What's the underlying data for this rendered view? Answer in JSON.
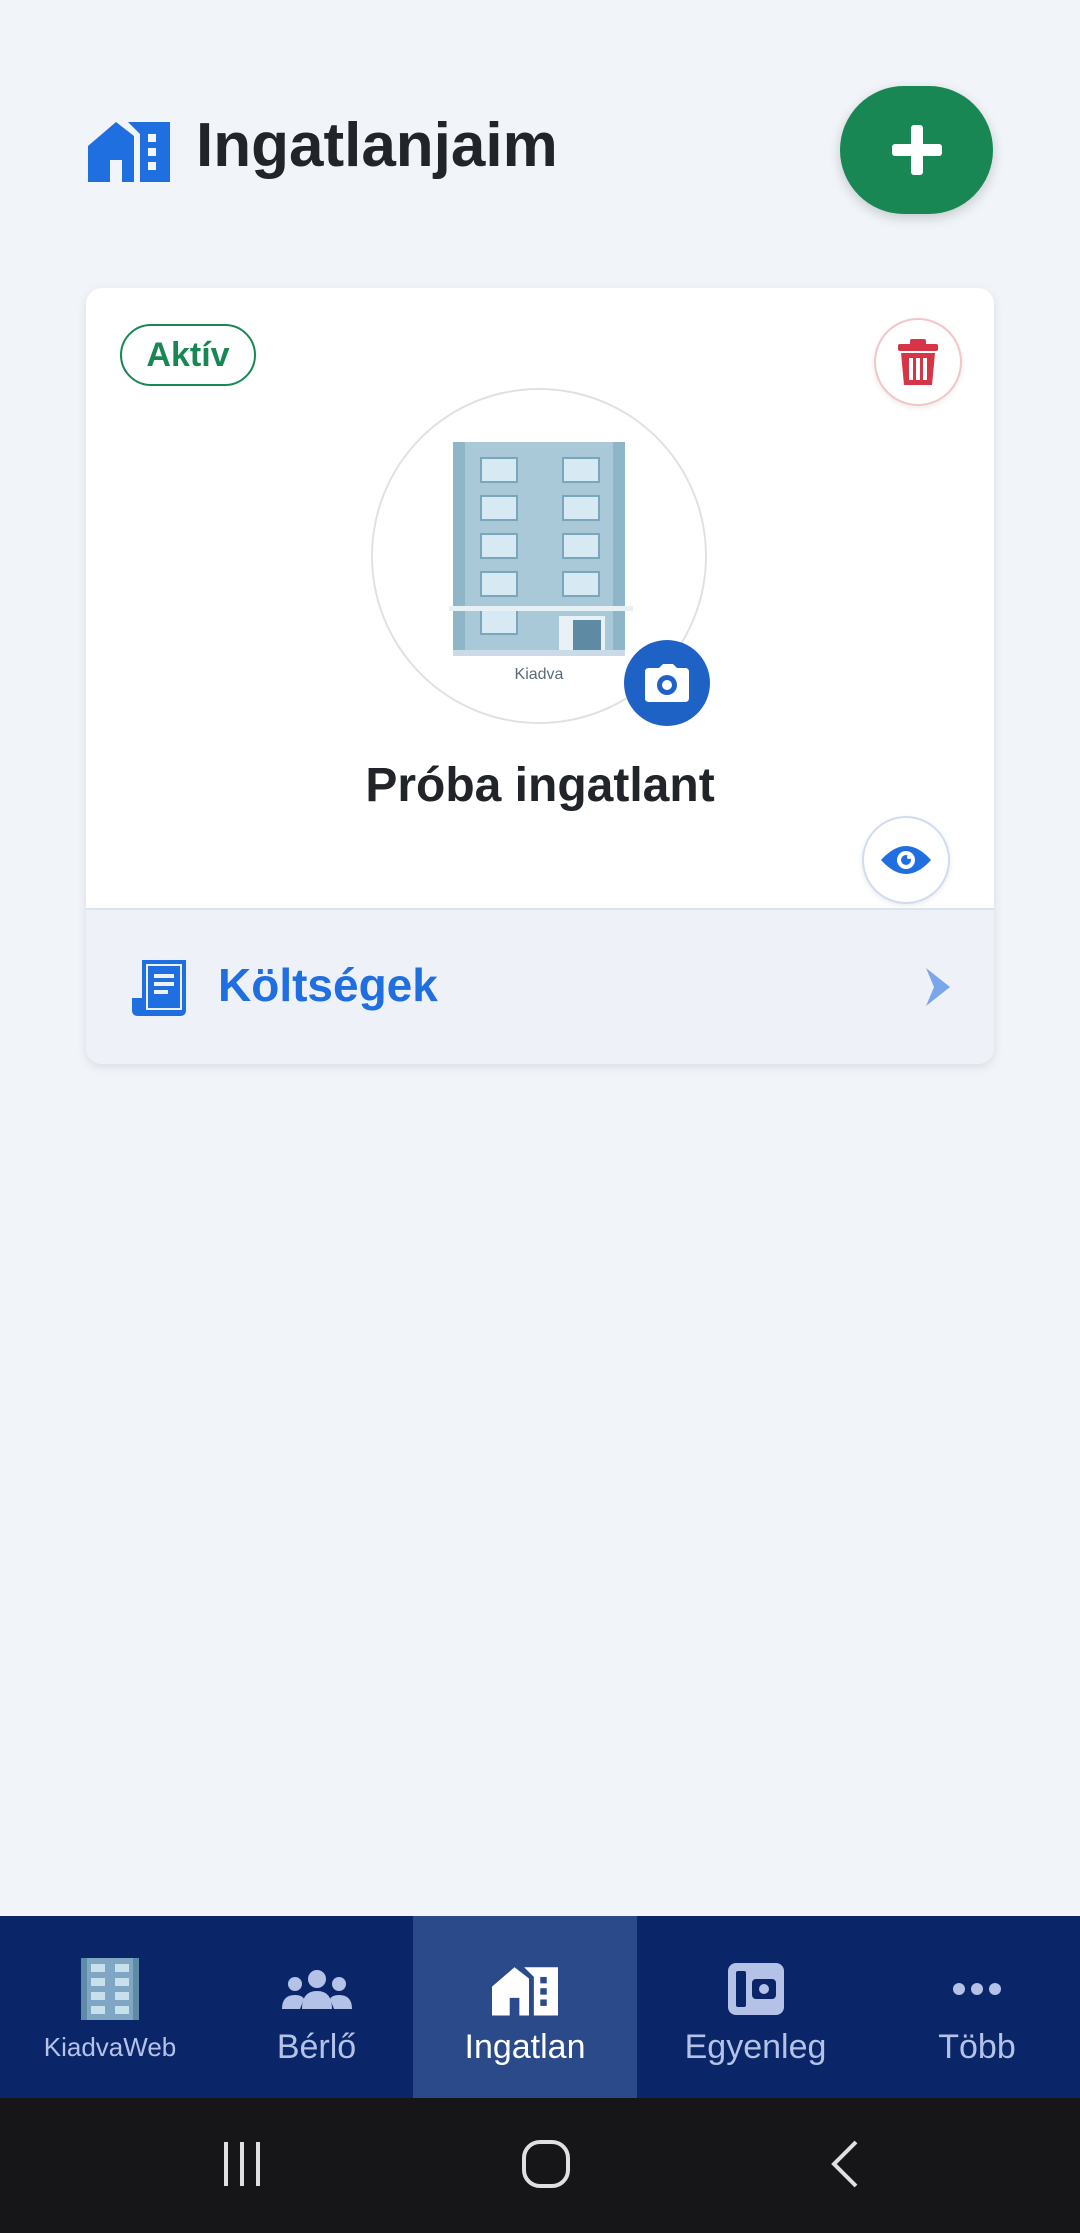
{
  "header": {
    "title": "Ingatlanjaim",
    "add_icon": "plus-icon"
  },
  "property_card": {
    "status": "Aktív",
    "photo_caption": "Kiadva",
    "name": "Próba ingatlant",
    "costs_label": "Költségek"
  },
  "bottom_nav": {
    "items": [
      {
        "label": "KiadvaWeb",
        "icon": "building-logo-icon"
      },
      {
        "label": "Bérlő",
        "icon": "users-icon"
      },
      {
        "label": "Ingatlan",
        "icon": "house-building-icon",
        "active": true
      },
      {
        "label": "Egyenleg",
        "icon": "wallet-icon"
      },
      {
        "label": "Több",
        "icon": "more-dots-icon"
      }
    ]
  },
  "colors": {
    "primary": "#1f6fe0",
    "success": "#198754",
    "danger": "#dc3545",
    "nav_bg": "#0b2569",
    "nav_active": "#2a4a8a"
  }
}
